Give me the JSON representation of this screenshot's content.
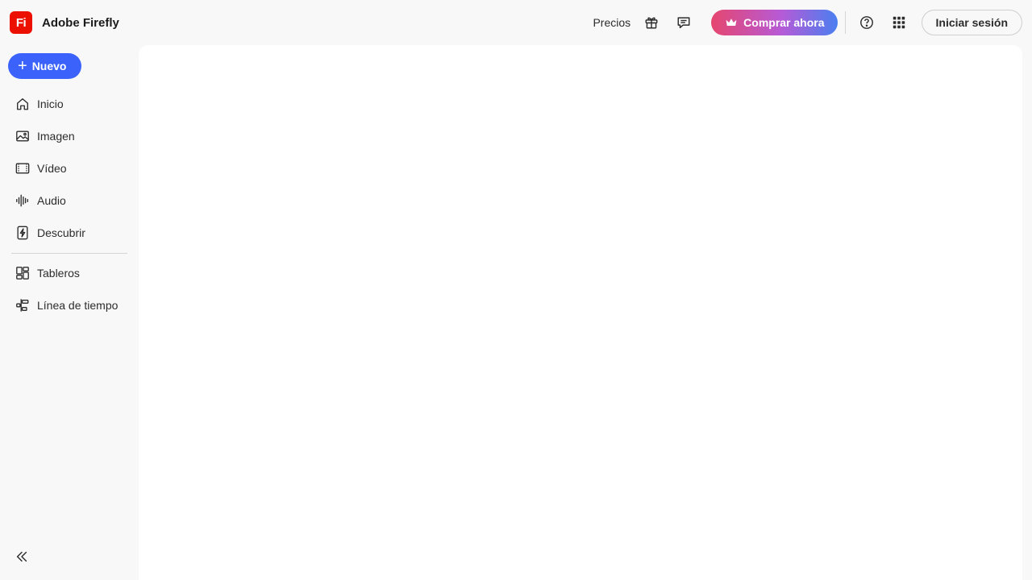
{
  "header": {
    "app_name": "Adobe Firefly",
    "logo_text": "Fi",
    "pricing_label": "Precios",
    "buy_label": "Comprar ahora",
    "signin_label": "Iniciar sesión"
  },
  "sidebar": {
    "new_label": "Nuevo",
    "items": [
      {
        "label": "Inicio",
        "icon": "home-icon"
      },
      {
        "label": "Imagen",
        "icon": "image-icon"
      },
      {
        "label": "Vídeo",
        "icon": "video-icon"
      },
      {
        "label": "Audio",
        "icon": "audio-icon"
      },
      {
        "label": "Descubrir",
        "icon": "discover-icon"
      },
      {
        "label": "Tableros",
        "icon": "boards-icon"
      },
      {
        "label": "Línea de tiempo",
        "icon": "timeline-icon"
      }
    ]
  },
  "colors": {
    "brand": "#eb1000",
    "primary": "#3b63fb",
    "background": "#f8f8f8",
    "canvas": "#ffffff"
  }
}
